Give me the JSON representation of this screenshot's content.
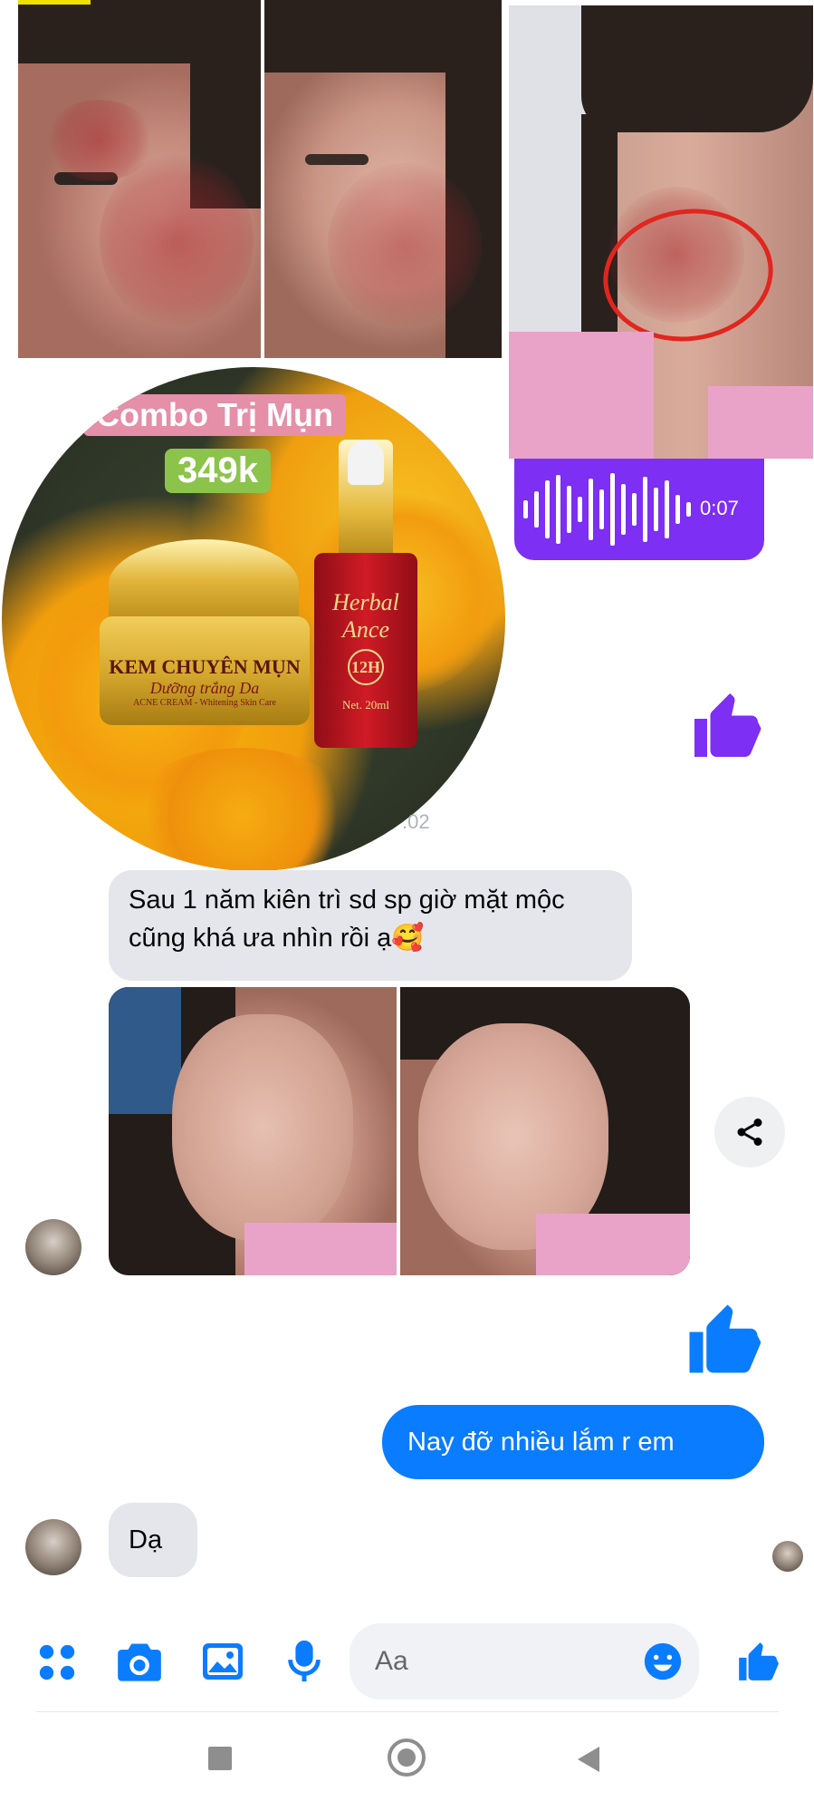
{
  "top_photos": {
    "voice_message": {
      "duration": "0:07"
    }
  },
  "product_ad": {
    "combo_title": "Combo Trị Mụn",
    "price": "349k",
    "jar_label_1": "KEM CHUYÊN MỤN",
    "jar_label_2": "Dưỡng trắng Da",
    "jar_label_3": "ACNE CREAM - Whitening Skin Care",
    "bottle_brand_1": "Herbal",
    "bottle_brand_2": "Ance",
    "bottle_badge": "12H",
    "bottle_volume": "Net. 20ml"
  },
  "timestamp": ".02",
  "messages": [
    {
      "text": "Sau 1 năm kiên trì sd sp giờ mặt mộc cũng khá ưa nhìn rồi ạ🥰"
    },
    {
      "text": "Nay đỡ nhiều lắm r em"
    },
    {
      "text": "Dạ"
    }
  ],
  "composer": {
    "placeholder": "Aa"
  },
  "colors": {
    "messenger_blue": "#0a7cff",
    "bubble_gray": "#e4e6eb",
    "voice_purple": "#7d2ff3",
    "like_thumb": "#7d2ff3"
  }
}
